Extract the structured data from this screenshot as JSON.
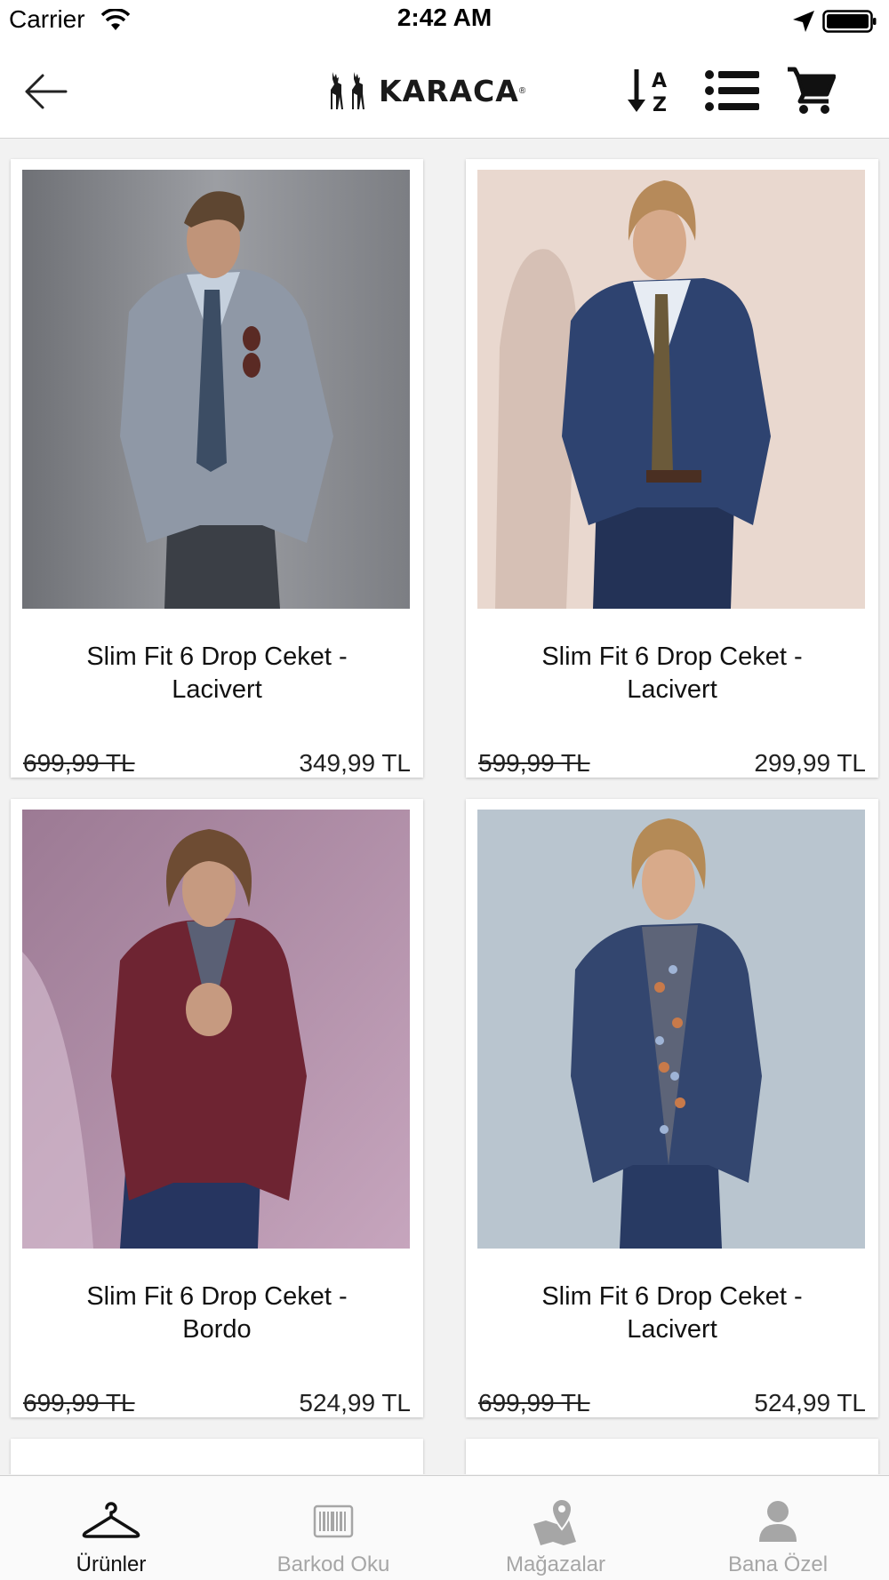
{
  "status_bar": {
    "carrier": "Carrier",
    "time": "2:42 AM"
  },
  "nav": {
    "logo_text": "KARACA",
    "logo_reg": "®",
    "icons": [
      "back-arrow-icon",
      "sort-az-icon",
      "list-view-icon",
      "cart-icon"
    ]
  },
  "products": [
    {
      "name": "Slim Fit 6 Drop Ceket - Lacivert",
      "old_price": "699,99 TL",
      "new_price": "349,99 TL"
    },
    {
      "name": "Slim Fit 6 Drop Ceket - Lacivert",
      "old_price": "599,99 TL",
      "new_price": "299,99 TL"
    },
    {
      "name": "Slim Fit 6 Drop Ceket - Bordo",
      "old_price": "699,99 TL",
      "new_price": "524,99 TL"
    },
    {
      "name": "Slim Fit 6 Drop Ceket - Lacivert",
      "old_price": "699,99 TL",
      "new_price": "524,99 TL"
    }
  ],
  "tabs": [
    {
      "label": "Ürünler",
      "icon": "hanger-icon",
      "active": true
    },
    {
      "label": "Barkod Oku",
      "icon": "barcode-icon",
      "active": false
    },
    {
      "label": "Mağazalar",
      "icon": "map-pin-icon",
      "active": false
    },
    {
      "label": "Bana Özel",
      "icon": "user-icon",
      "active": false
    }
  ],
  "colors": {
    "active_tab": "#111111",
    "inactive_tab": "#a6a6a6",
    "background": "#f2f2f2"
  }
}
